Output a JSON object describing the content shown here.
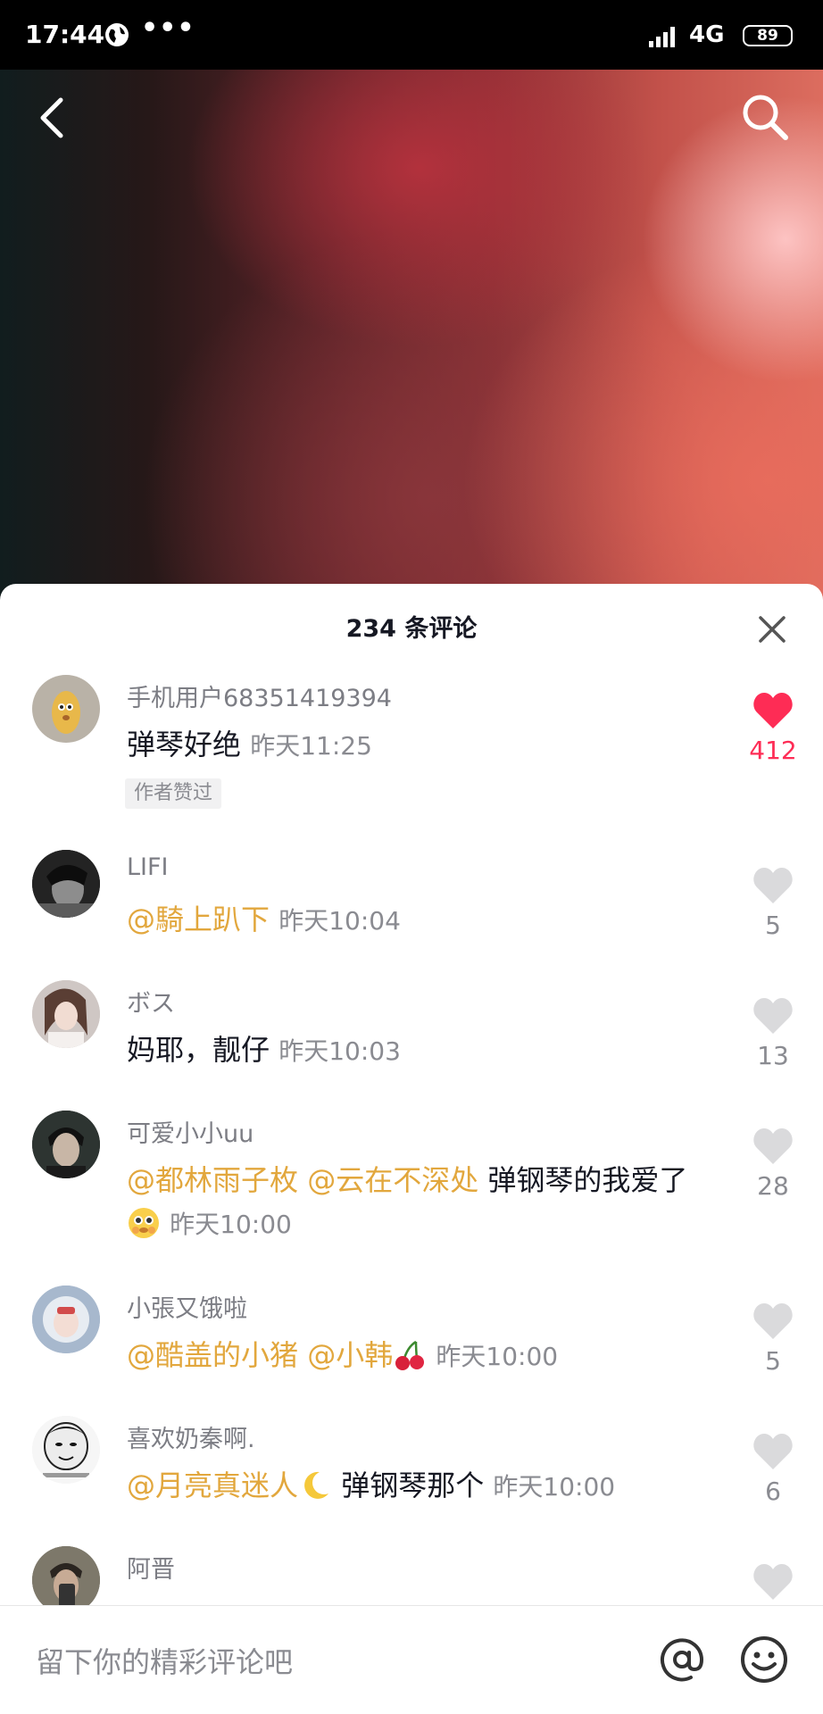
{
  "status_bar": {
    "time": "17:44",
    "dots": "•••",
    "network": "4G",
    "battery": "89"
  },
  "sheet": {
    "title": "234 条评论"
  },
  "comments": [
    {
      "user": "手机用户68351419394",
      "text": "弹琴好绝",
      "time": "昨天11:25",
      "tag": "作者赞过",
      "likes": "412"
    },
    {
      "user": "LIFI",
      "mention1": "@騎上趴下",
      "time": "昨天10:04",
      "likes": "5"
    },
    {
      "user": "ボス",
      "text": "妈耶，靓仔",
      "time": "昨天10:03",
      "likes": "13"
    },
    {
      "user": "可爱小小uu",
      "mention1": "@都林雨子枚",
      "mention2": "@云在不深处",
      "text": "弹钢琴的我爱了",
      "time": "昨天10:00",
      "likes": "28"
    },
    {
      "user": "小張又饿啦",
      "mention1": "@酷盖的小猪",
      "mention2": "@小韩",
      "time": "昨天10:00",
      "likes": "5"
    },
    {
      "user": "喜欢奶秦啊.",
      "mention1": "@月亮真迷人",
      "text": "弹钢琴那个",
      "time": "昨天10:00",
      "likes": "6"
    },
    {
      "user": "阿晋"
    }
  ],
  "input": {
    "placeholder": "留下你的精彩评论吧"
  },
  "colors": {
    "like_active": "#fe2c55",
    "mention": "#e2a73d",
    "text_secondary": "#8a8b91"
  },
  "icons": [
    "globe-icon",
    "signal-icon",
    "back-icon",
    "search-icon",
    "close-icon",
    "heart-icon",
    "at-icon",
    "emoji-icon",
    "cherry-icon",
    "moon-icon"
  ]
}
